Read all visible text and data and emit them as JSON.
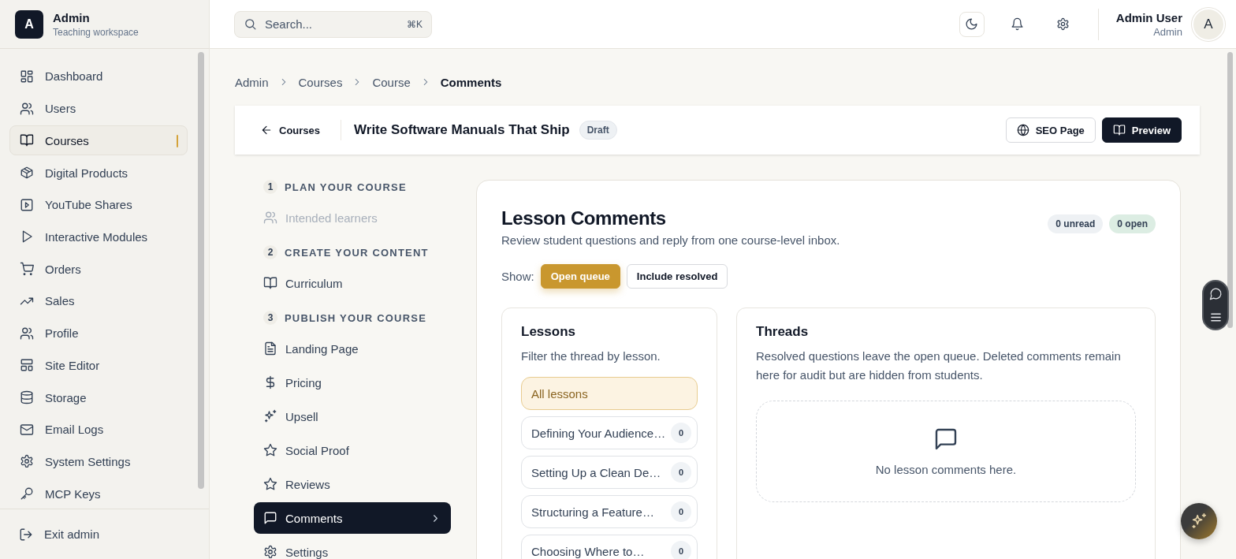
{
  "brand": {
    "logo": "A",
    "name": "Admin",
    "subtitle": "Teaching workspace"
  },
  "sidebar": {
    "items": [
      {
        "label": "Dashboard",
        "selected": false
      },
      {
        "label": "Users",
        "selected": false
      },
      {
        "label": "Courses",
        "selected": true
      },
      {
        "label": "Digital Products",
        "selected": false
      },
      {
        "label": "YouTube Shares",
        "selected": false
      },
      {
        "label": "Interactive Modules",
        "selected": false
      },
      {
        "label": "Orders",
        "selected": false
      },
      {
        "label": "Sales",
        "selected": false
      },
      {
        "label": "Profile",
        "selected": false
      },
      {
        "label": "Site Editor",
        "selected": false
      },
      {
        "label": "Storage",
        "selected": false
      },
      {
        "label": "Email Logs",
        "selected": false
      },
      {
        "label": "System Settings",
        "selected": false
      },
      {
        "label": "MCP Keys",
        "selected": false
      }
    ],
    "footer": {
      "label": "Exit admin"
    }
  },
  "topbar": {
    "search": {
      "placeholder": "Search...",
      "shortcut": "⌘K"
    },
    "user": {
      "name": "Admin User",
      "role": "Admin",
      "avatar": "A"
    }
  },
  "breadcrumb": [
    "Admin",
    "Courses",
    "Course",
    "Comments"
  ],
  "course_header": {
    "back": "Courses",
    "title": "Write Software Manuals That Ship",
    "status": "Draft",
    "buttons": [
      {
        "label": "SEO Page",
        "kind": "outline"
      },
      {
        "label": "Preview",
        "kind": "solid"
      }
    ]
  },
  "steps": [
    {
      "number": "1",
      "title": "PLAN YOUR COURSE",
      "items": [
        {
          "label": "Intended learners",
          "disabled": true,
          "selected": false
        }
      ]
    },
    {
      "number": "2",
      "title": "CREATE YOUR CONTENT",
      "items": [
        {
          "label": "Curriculum",
          "disabled": false,
          "selected": false
        }
      ]
    },
    {
      "number": "3",
      "title": "PUBLISH YOUR COURSE",
      "items": [
        {
          "label": "Landing Page",
          "disabled": false,
          "selected": false
        },
        {
          "label": "Pricing",
          "disabled": false,
          "selected": false
        },
        {
          "label": "Upsell",
          "disabled": false,
          "selected": false
        },
        {
          "label": "Social Proof",
          "disabled": false,
          "selected": false
        },
        {
          "label": "Reviews",
          "disabled": false,
          "selected": false
        },
        {
          "label": "Comments",
          "disabled": false,
          "selected": true
        },
        {
          "label": "Settings",
          "disabled": false,
          "selected": false
        }
      ]
    }
  ],
  "comments": {
    "title": "Lesson Comments",
    "subtitle": "Review student questions and reply from one course-level inbox.",
    "badges": [
      {
        "label": "0 unread",
        "color": "#eef1f4"
      },
      {
        "label": "0 open",
        "color": "#dcede3"
      }
    ],
    "filter": {
      "label": "Show:",
      "options": [
        {
          "label": "Open queue",
          "selected": true
        },
        {
          "label": "Include resolved",
          "selected": false
        }
      ]
    },
    "lessons": {
      "title": "Lessons",
      "subtitle": "Filter the thread by lesson.",
      "items": [
        {
          "label": "All lessons",
          "selected": true
        },
        {
          "label": "Defining Your Audience…",
          "count": "0",
          "selected": false
        },
        {
          "label": "Setting Up a Clean De…",
          "count": "0",
          "selected": false
        },
        {
          "label": "Structuring a Feature…",
          "count": "0",
          "selected": false
        },
        {
          "label": "Choosing Where to…",
          "count": "0",
          "selected": false
        }
      ]
    },
    "threads": {
      "title": "Threads",
      "description": "Resolved questions leave the open queue. Deleted comments remain here for audit but are hidden from students.",
      "empty": "No lesson comments here."
    }
  }
}
